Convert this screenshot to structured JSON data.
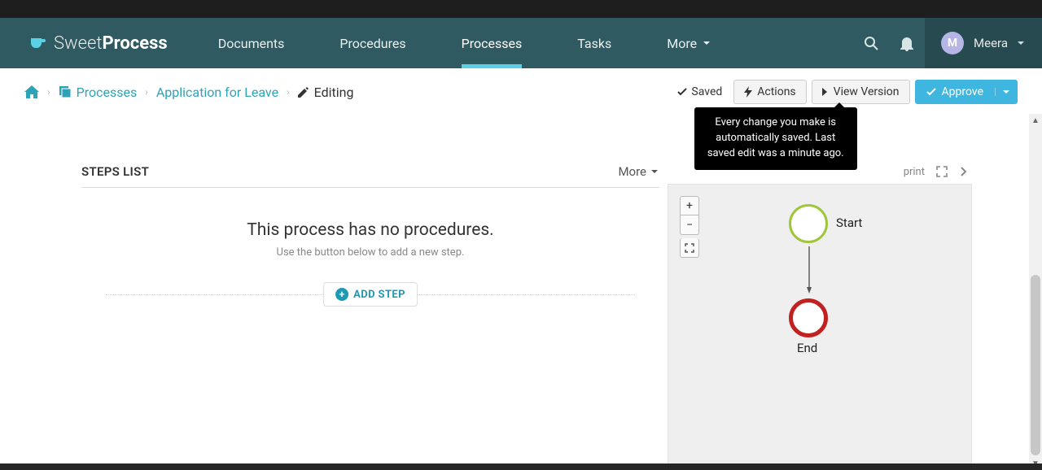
{
  "brand": {
    "thin": "Sweet",
    "bold": "Process"
  },
  "nav": {
    "items": [
      {
        "label": "Documents",
        "active": false
      },
      {
        "label": "Procedures",
        "active": false
      },
      {
        "label": "Processes",
        "active": true
      },
      {
        "label": "Tasks",
        "active": false
      },
      {
        "label": "More",
        "active": false,
        "caret": true
      }
    ]
  },
  "user": {
    "initial": "M",
    "name": "Meera"
  },
  "breadcrumb": {
    "home_icon": "home",
    "items": [
      {
        "label": "Processes",
        "link": true
      },
      {
        "label": "Application for Leave",
        "link": true
      },
      {
        "label": "Editing",
        "link": false,
        "icon": "pencil"
      }
    ]
  },
  "toolbar": {
    "saved_label": "Saved",
    "actions_label": "Actions",
    "view_version_label": "View Version",
    "approve_label": "Approve",
    "tooltip": "Every change you make is automatically saved. Last saved edit was a minute ago."
  },
  "steps": {
    "title": "STEPS LIST",
    "more_label": "More",
    "empty_title": "This process has no procedures.",
    "empty_sub": "Use the button below to add a new step.",
    "add_label": "ADD STEP"
  },
  "canvas": {
    "print_label": "print",
    "zoom_in": "+",
    "zoom_out": "−",
    "start_label": "Start",
    "end_label": "End"
  }
}
